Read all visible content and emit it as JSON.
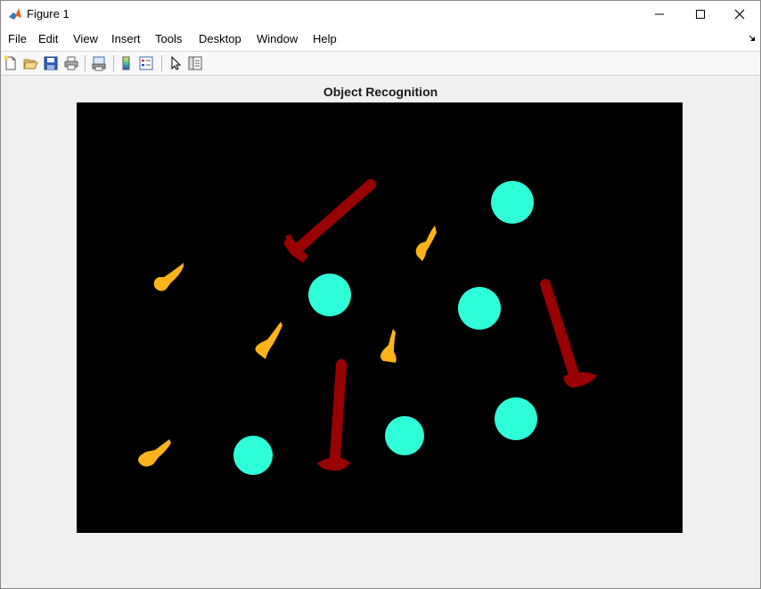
{
  "window": {
    "title": "Figure 1"
  },
  "menu": [
    "File",
    "Edit",
    "View",
    "Insert",
    "Tools",
    "Desktop",
    "Window",
    "Help"
  ],
  "toolbar": [
    "new-figure-icon",
    "open-file-icon",
    "save-icon",
    "print-icon",
    "print-preview-icon",
    "colorbar-icon",
    "legend-icon",
    "pointer-icon",
    "property-inspector-icon"
  ],
  "plot": {
    "title": "Object Recognition"
  },
  "colors": {
    "background": "#000000",
    "teal": "#2effd9",
    "red": "#990000",
    "orange": "#ffb31a"
  }
}
